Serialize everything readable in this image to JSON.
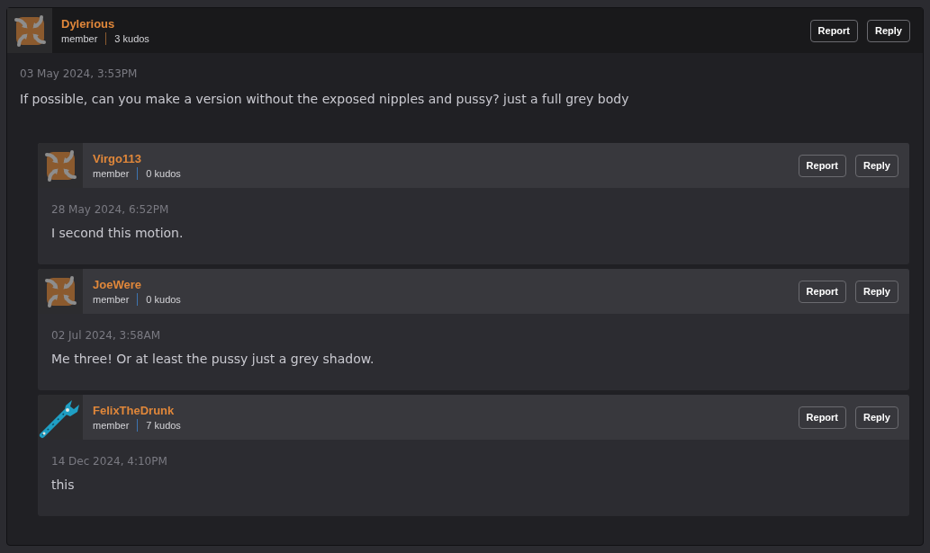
{
  "post": {
    "avatar": {
      "kind": "pinwheel"
    },
    "author": "Dylerious",
    "role": "member",
    "kudos": "3 kudos",
    "buttons": [
      "Report",
      "Reply"
    ],
    "date": "03 May 2024, 3:53PM",
    "body": "If possible, can you make a version without the exposed nipples and pussy? just a full grey body"
  },
  "replies": [
    {
      "avatar": {
        "kind": "pinwheel"
      },
      "author": "Virgo113",
      "role": "member",
      "kudos": "0 kudos",
      "buttons": [
        "Report",
        "Reply"
      ],
      "date": "28 May 2024, 6:52PM",
      "body": "I second this motion."
    },
    {
      "avatar": {
        "kind": "pinwheel"
      },
      "author": "JoeWere",
      "role": "member",
      "kudos": "0 kudos",
      "buttons": [
        "Report",
        "Reply"
      ],
      "date": "02 Jul 2024, 3:58AM",
      "body": "Me three! Or at least the pussy just a grey shadow."
    },
    {
      "avatar": {
        "kind": "wrench"
      },
      "author": "FelixTheDrunk",
      "role": "member",
      "kudos": "7 kudos",
      "buttons": [
        "Report",
        "Reply"
      ],
      "date": "14 Dec 2024, 4:10PM",
      "body": "this"
    }
  ]
}
